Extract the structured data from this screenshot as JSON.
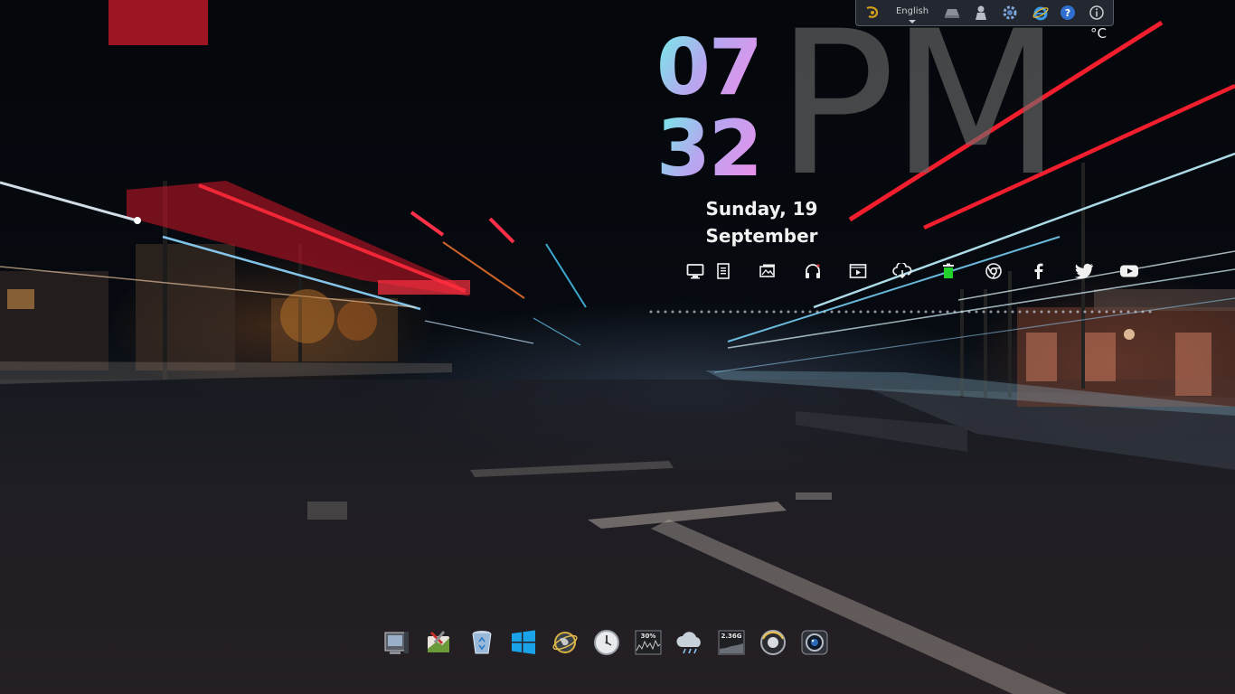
{
  "clock": {
    "hour": "07",
    "minute": "32",
    "ampm": "PM",
    "date_line1": "Sunday, 19",
    "date_line2": "September",
    "temperature_unit": "°C"
  },
  "topbar": {
    "language": "English",
    "icons": [
      "logo-icon",
      "language-select",
      "drive-icon",
      "user-icon",
      "settings-icon",
      "internet-explorer-icon",
      "help-icon",
      "info-icon"
    ]
  },
  "launcher": {
    "icons": [
      "monitor-icon",
      "document-icon",
      "pictures-icon",
      "headphones-icon",
      "video-icon",
      "cloud-download-icon",
      "trash-full-icon",
      "chrome-icon",
      "facebook-icon",
      "twitter-icon",
      "youtube-icon"
    ]
  },
  "dock": {
    "icons": [
      "computer-icon",
      "tools-icon",
      "recycle-bin-icon",
      "windows-icon",
      "network-globe-icon",
      "clock-icon",
      "cpu-meter-icon",
      "weather-icon",
      "disk-meter-icon",
      "speaker-icon",
      "camera-icon"
    ],
    "cpu_label": "30%",
    "disk_label": "2.36G"
  },
  "colors": {
    "digits_gradient_start": "#6ff0e6",
    "digits_gradient_end": "#f08ce8",
    "ampm": "#6e6e6e",
    "launcher_icon": "#f0f0f0",
    "trash_green": "#22d22a"
  }
}
